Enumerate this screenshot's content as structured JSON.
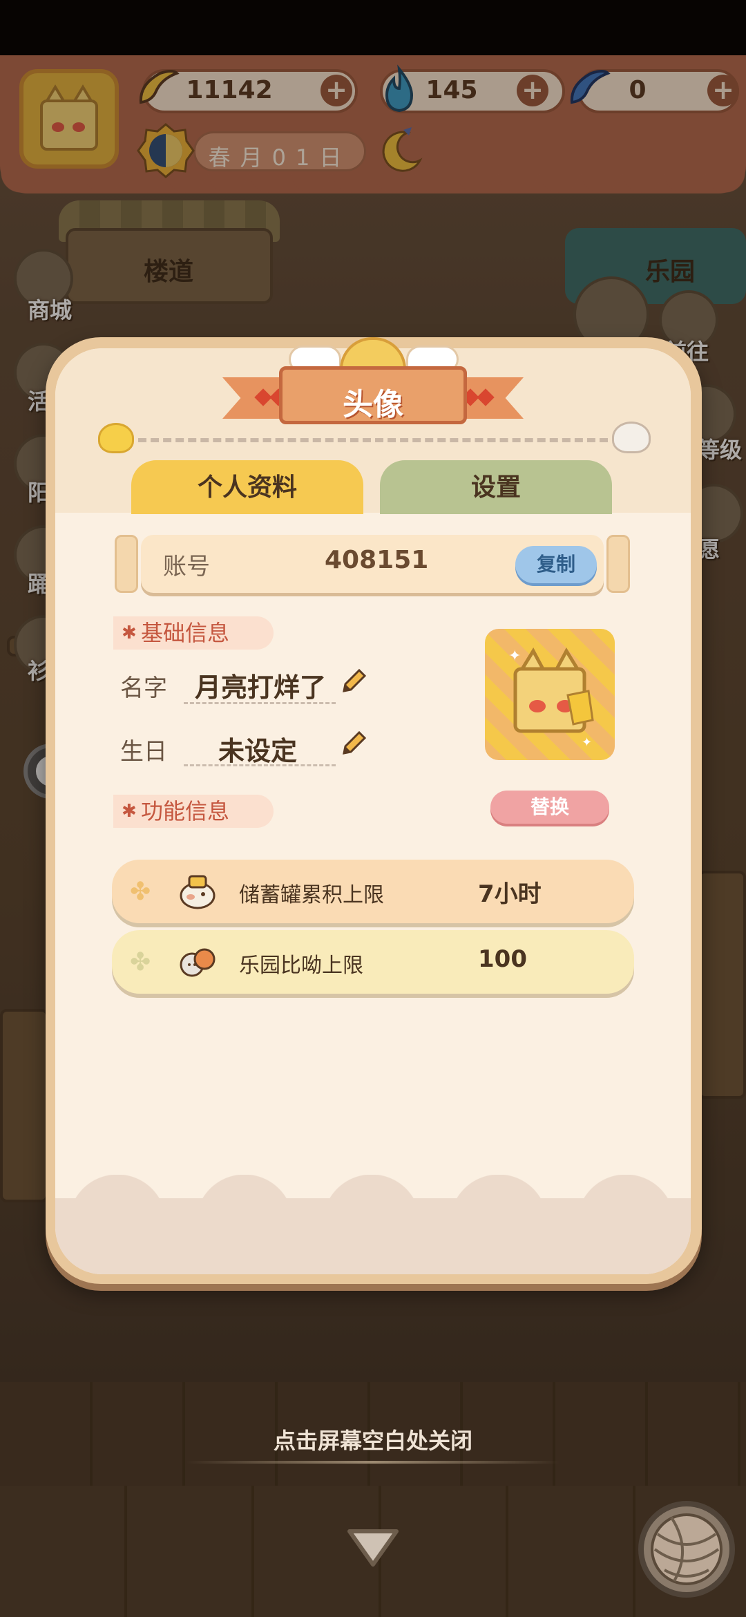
{
  "hud": {
    "bananas": "11142",
    "flames": "145",
    "blue_bananas": "0",
    "date": "春月01日"
  },
  "scene": {
    "store_label": "楼道",
    "park_label": "乐园",
    "side_left": [
      "商城",
      "活",
      "阳",
      "踊",
      "衫"
    ],
    "side_right": [
      "前往",
      "等级",
      "愿"
    ]
  },
  "modal": {
    "title": "头像",
    "tabs": {
      "profile": "个人资料",
      "settings": "设置"
    },
    "account": {
      "label": "账号",
      "value": "408151",
      "copy_label": "复制"
    },
    "basic_info": {
      "header": "基础信息",
      "name_label": "名字",
      "name_value": "月亮打烊了",
      "birthday_label": "生日",
      "birthday_value": "未设定"
    },
    "replace_label": "替换",
    "feature_info": {
      "header": "功能信息",
      "rows": [
        {
          "label": "储蓄罐累积上限",
          "value": "7小时"
        },
        {
          "label": "乐园比呦上限",
          "value": "100"
        }
      ]
    }
  },
  "close_hint": "点击屏幕空白处关闭",
  "colors": {
    "hud_bg": "#b66a4f",
    "tab_active": "#f6c951",
    "tab_inactive": "#b8c391",
    "copy_btn": "#9fc6e9",
    "replace_btn": "#f0a3a3"
  },
  "icons": [
    "banana-icon",
    "blue-flame-icon",
    "blue-banana-icon",
    "plus-icon",
    "season-clock-icon",
    "moon-icon",
    "pencil-icon",
    "clover-icon",
    "piggy-bank-icon",
    "cat-pair-icon",
    "down-arrow-icon",
    "yarn-ball-icon"
  ]
}
